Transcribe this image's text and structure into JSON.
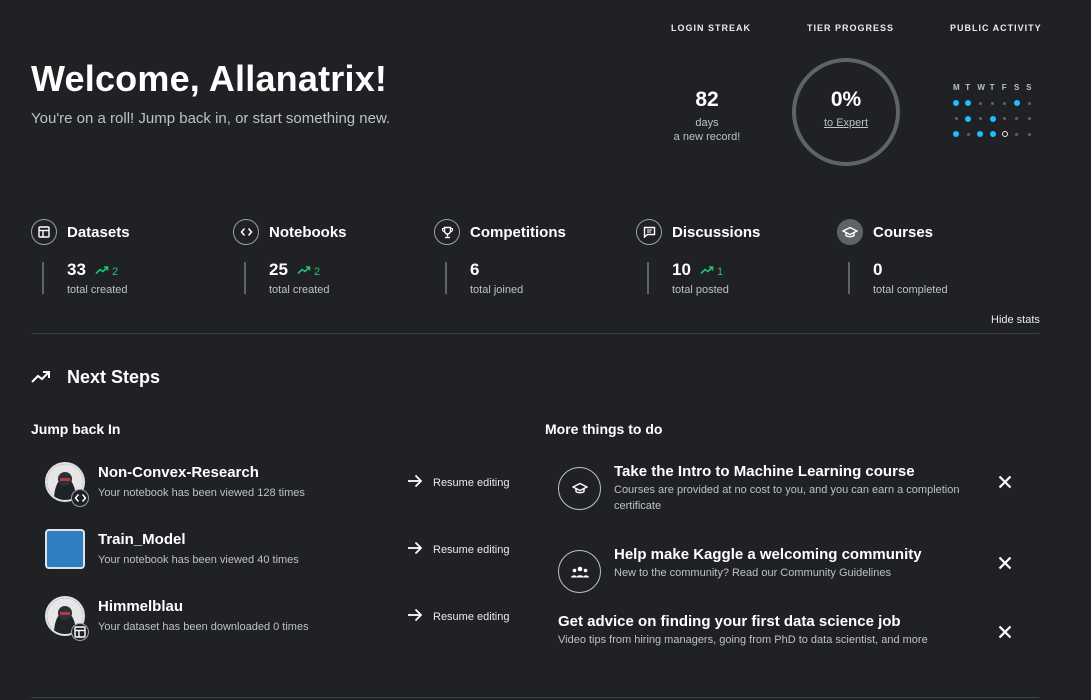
{
  "header": {
    "title": "Welcome, Allanatrix!",
    "subtitle": "You're on a roll! Jump back in, or start something new."
  },
  "login_streak": {
    "label": "LOGIN STREAK",
    "days": "82",
    "unit": "days",
    "note": "a new record!"
  },
  "tier_progress": {
    "label": "TIER PROGRESS",
    "percent": "0%",
    "target": "to Expert",
    "progress_value": 0
  },
  "public_activity": {
    "label": "PUBLIC ACTIVITY",
    "days": [
      "M",
      "T",
      "W",
      "T",
      "F",
      "S",
      "S"
    ],
    "weeks": [
      [
        "on",
        "on",
        "off",
        "off",
        "off",
        "on",
        "off"
      ],
      [
        "off",
        "on",
        "off",
        "on",
        "off",
        "off",
        "off"
      ],
      [
        "on",
        "off",
        "on",
        "on",
        "today",
        "off",
        "off"
      ]
    ]
  },
  "stats": [
    {
      "title": "Datasets",
      "value": "33",
      "delta": "2",
      "caption": "total created",
      "icon": "table-icon"
    },
    {
      "title": "Notebooks",
      "value": "25",
      "delta": "2",
      "caption": "total created",
      "icon": "code-icon"
    },
    {
      "title": "Competitions",
      "value": "6",
      "delta": "",
      "caption": "total joined",
      "icon": "trophy-icon"
    },
    {
      "title": "Discussions",
      "value": "10",
      "delta": "1",
      "caption": "total posted",
      "icon": "comment-icon"
    },
    {
      "title": "Courses",
      "value": "0",
      "delta": "",
      "caption": "total completed",
      "icon": "graduation-cap-icon"
    }
  ],
  "hide_stats_label": "Hide stats",
  "next_steps": {
    "title": "Next Steps",
    "jump_back_title": "Jump back In",
    "more_things_title": "More things to do",
    "resume_label": "Resume editing",
    "jump_back_items": [
      {
        "title": "Non-Convex-Research",
        "subtitle": "Your notebook has been viewed 128 times",
        "badge": "code-icon"
      },
      {
        "title": "Train_Model",
        "subtitle": "Your notebook has been viewed 40 times",
        "badge": ""
      },
      {
        "title": "Himmelblau",
        "subtitle": "Your dataset has been downloaded 0 times",
        "badge": "table-icon"
      }
    ],
    "todo_items": [
      {
        "title": "Take the Intro to Machine Learning course",
        "desc": "Courses are provided at no cost to you, and you can earn a completion certificate",
        "icon": "graduation-cap-icon"
      },
      {
        "title": "Help make Kaggle a welcoming community",
        "desc": "New to the community? Read our Community Guidelines",
        "icon": "people-icon"
      },
      {
        "title": "Get advice on finding your first data science job",
        "desc": "Video tips from hiring managers, going from PhD to data scientist, and more",
        "icon": ""
      }
    ]
  },
  "colors": {
    "background": "#202124",
    "accent": "#20beff",
    "positive": "#1ec27a"
  }
}
